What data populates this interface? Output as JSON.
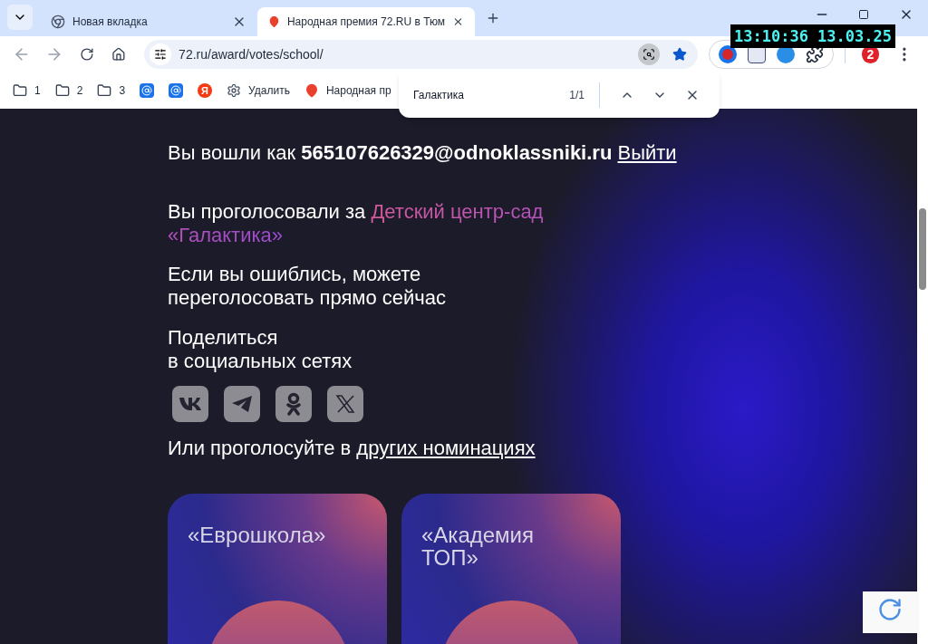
{
  "browser": {
    "tabs": [
      {
        "title": "Новая вкладка",
        "kind": "chrome",
        "selected": false
      },
      {
        "title": "Народная премия 72.RU в Тюм",
        "kind": "pin",
        "selected": true
      }
    ],
    "address": "72.ru/award/votes/school/",
    "bookmarks": [
      {
        "kind": "folder",
        "label": "1"
      },
      {
        "kind": "folder",
        "label": "2"
      },
      {
        "kind": "folder",
        "label": "3"
      },
      {
        "kind": "mail"
      },
      {
        "kind": "mail"
      },
      {
        "kind": "yandex",
        "label": "Я"
      },
      {
        "kind": "gear",
        "label": "Удалить"
      },
      {
        "kind": "pin",
        "label": "Народная пр"
      }
    ],
    "profile_badge": "2",
    "find_bar": {
      "query": "Галактика",
      "count": "1/1"
    }
  },
  "clock_overlay": "13:10:36 13.03.25",
  "page": {
    "login": {
      "text": "Вы вошли как **565107626329@odnoklassniki.ru**",
      "logout": "Выйти"
    },
    "vote": {
      "text": "Вы проголосовали за",
      "nominee": "Детский центр-сад «Галактика»"
    },
    "revote": "Если вы ошиблись, можете\nпереголосовать прямо сейчас",
    "share": {
      "title": "Поделиться\nв социальных сетях",
      "networks": [
        {
          "kind": "vk"
        },
        {
          "kind": "telegram"
        },
        {
          "kind": "ok"
        },
        {
          "kind": "x"
        }
      ]
    },
    "other": {
      "text": "Или проголосуйте в",
      "link": "других номинациях"
    },
    "cards": [
      {
        "title": "«Еврошкола»"
      },
      {
        "title": "«Академия\nТОП»"
      }
    ]
  }
}
